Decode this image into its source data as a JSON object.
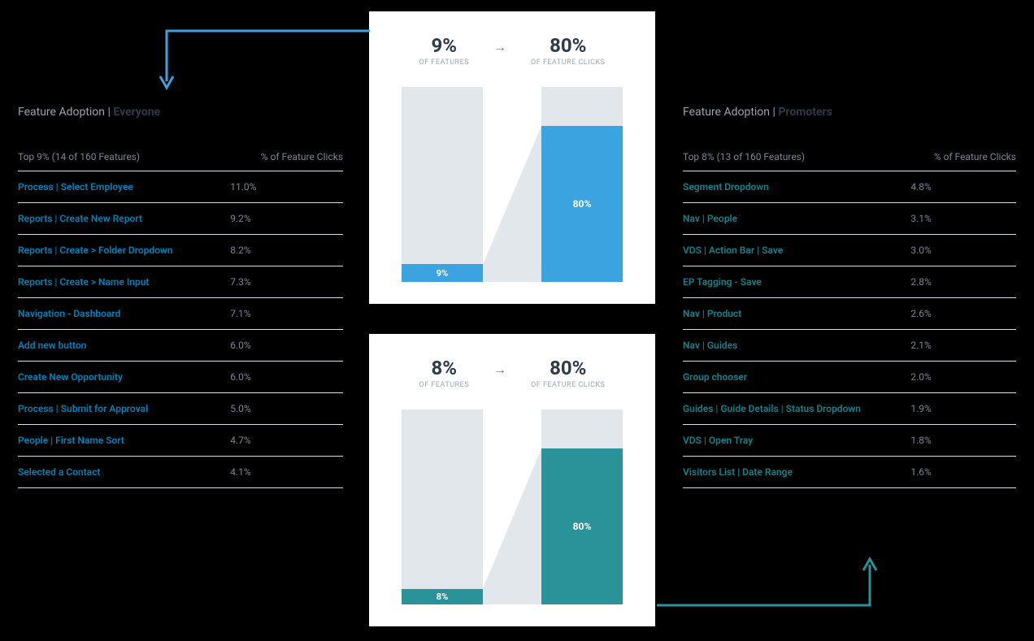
{
  "left": {
    "title_prefix": "Feature Adoption  |  ",
    "title_bold": "Everyone",
    "header_left": "Top 9%  (14 of 160 Features)",
    "header_right": "% of Feature Clicks",
    "rows": [
      {
        "name": "Process | Select Employee",
        "val": "11.0%"
      },
      {
        "name": "Reports | Create New Report",
        "val": "9.2%"
      },
      {
        "name": "Reports | Create > Folder Dropdown",
        "val": "8.2%"
      },
      {
        "name": "Reports | Create > Name Input",
        "val": "7.3%"
      },
      {
        "name": "Navigation - Dashboard",
        "val": "7.1%"
      },
      {
        "name": "Add new button",
        "val": "6.0%"
      },
      {
        "name": "Create New Opportunity",
        "val": "6.0%"
      },
      {
        "name": "Process | Submit for Approval",
        "val": "5.0%"
      },
      {
        "name": "People | First Name Sort",
        "val": "4.7%"
      },
      {
        "name": "Selected a Contact",
        "val": "4.1%"
      }
    ]
  },
  "right": {
    "title_prefix": "Feature Adoption  |  ",
    "title_bold": "Promoters",
    "header_left": "Top 8%  (13 of 160 Features)",
    "header_right": "% of Feature Clicks",
    "rows": [
      {
        "name": "Segment Dropdown",
        "val": "4.8%"
      },
      {
        "name": "Nav | People",
        "val": "3.1%"
      },
      {
        "name": "VDS | Action Bar | Save",
        "val": "3.0%"
      },
      {
        "name": "EP Tagging - Save",
        "val": "2.8%"
      },
      {
        "name": "Nav | Product",
        "val": "2.6%"
      },
      {
        "name": "Nav | Guides",
        "val": "2.1%"
      },
      {
        "name": "Group chooser",
        "val": "2.0%"
      },
      {
        "name": "Guides | Guide Details | Status Dropdown",
        "val": "1.9%"
      },
      {
        "name": "VDS | Open Tray",
        "val": "1.8%"
      },
      {
        "name": "Visitors List | Date Range",
        "val": "1.6%"
      }
    ]
  },
  "chart_top": {
    "left_big": "9%",
    "left_sub": "OF FEATURES",
    "right_big": "80%",
    "right_sub": "OF FEATURE CLICKS",
    "color": "#3BA3E0",
    "bar1_pct": 9,
    "bar1_label": "9%",
    "bar2_pct": 80,
    "bar2_label": "80%"
  },
  "chart_bot": {
    "left_big": "8%",
    "left_sub": "OF FEATURES",
    "right_big": "80%",
    "right_sub": "OF FEATURE CLICKS",
    "color": "#2A9299",
    "bar1_pct": 8,
    "bar1_label": "8%",
    "bar2_pct": 80,
    "bar2_label": "80%"
  },
  "chart_data": [
    {
      "type": "bar",
      "title": "Feature Adoption — Everyone",
      "categories": [
        "% of Features",
        "% of Feature Clicks"
      ],
      "values": [
        9,
        80
      ],
      "ylim": [
        0,
        100
      ],
      "color": "#3BA3E0"
    },
    {
      "type": "bar",
      "title": "Feature Adoption — Promoters",
      "categories": [
        "% of Features",
        "% of Feature Clicks"
      ],
      "values": [
        8,
        80
      ],
      "ylim": [
        0,
        100
      ],
      "color": "#2A9299"
    }
  ]
}
